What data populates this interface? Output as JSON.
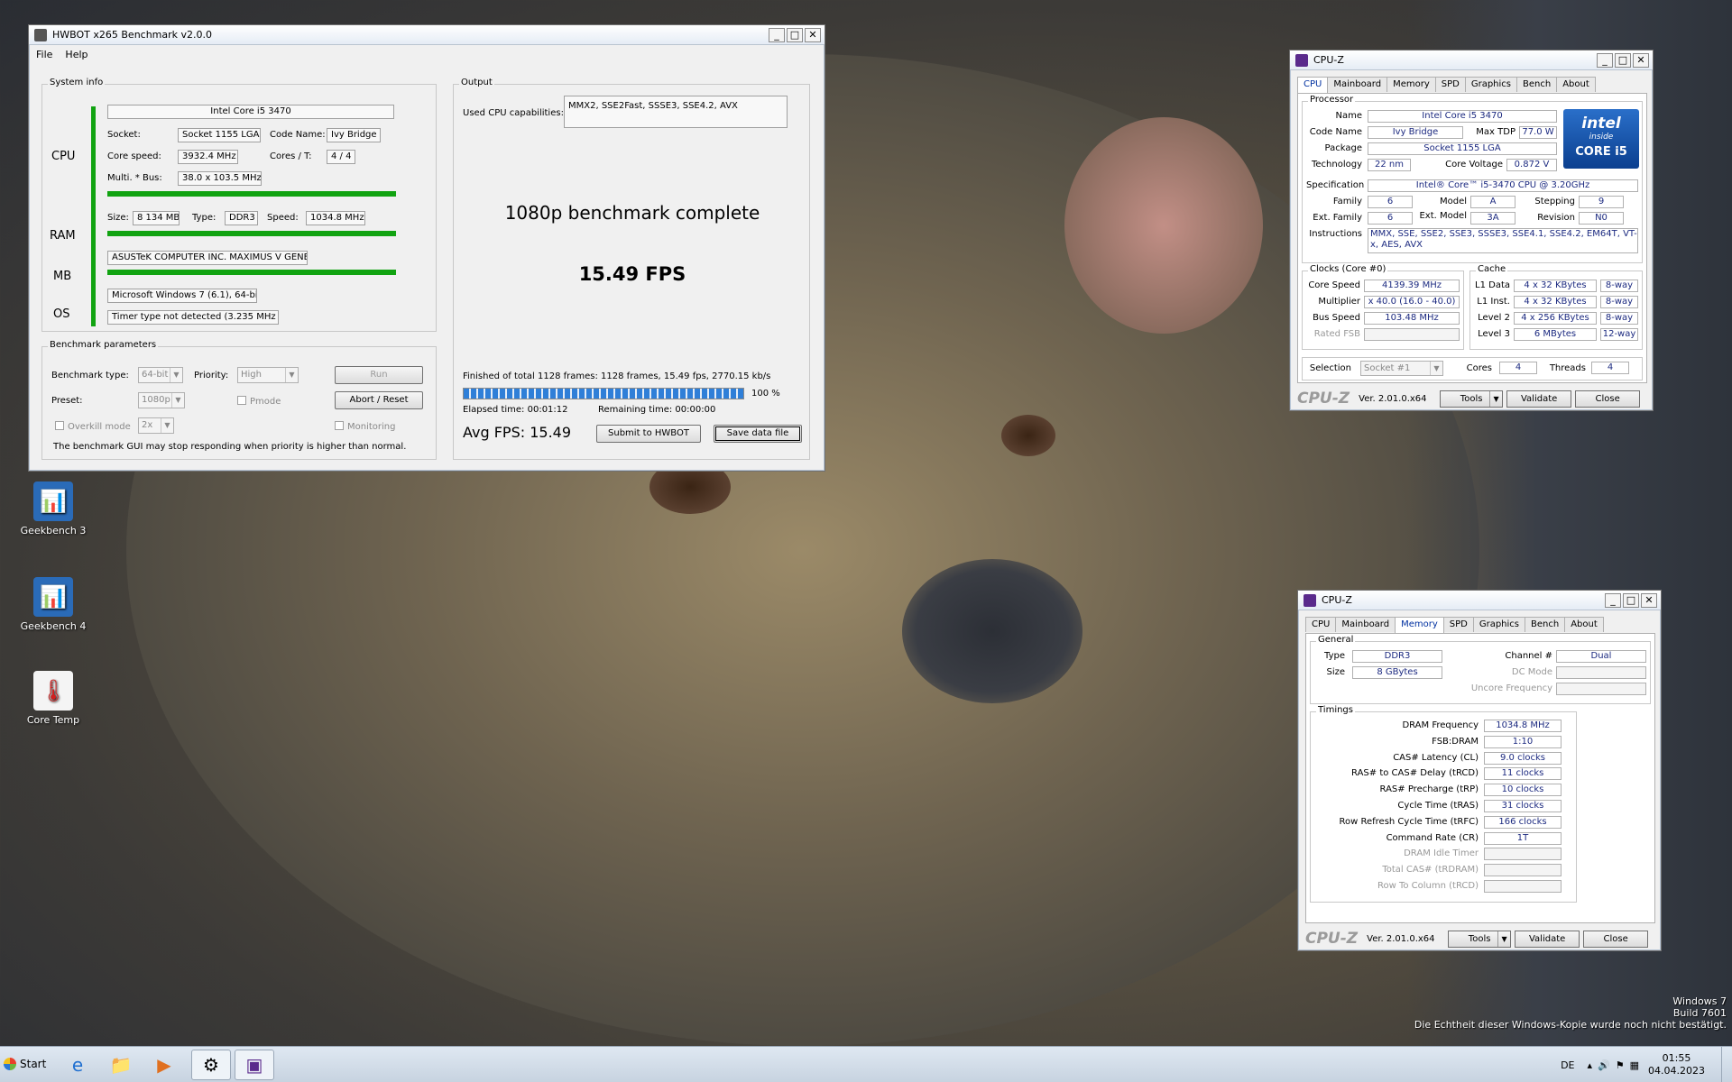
{
  "desktop": {
    "icons": [
      {
        "label": "Geekbench 3"
      },
      {
        "label": "Geekbench 4"
      },
      {
        "label": "Core Temp"
      }
    ],
    "watermark": [
      "Windows 7",
      "Build 7601",
      "Die Echtheit dieser Windows-Kopie wurde noch nicht bestätigt."
    ]
  },
  "hwbot": {
    "title": "HWBOT x265 Benchmark v2.0.0",
    "menu": [
      "File",
      "Help"
    ],
    "system_info": {
      "legend": "System info",
      "cpu_label": "CPU",
      "ram_label": "RAM",
      "mb_label": "MB",
      "os_label": "OS",
      "cpu_name": "Intel Core i5 3470",
      "socket_label": "Socket:",
      "socket": "Socket 1155 LGA",
      "codename_label": "Code Name:",
      "codename": "Ivy Bridge",
      "corespeed_label": "Core speed:",
      "corespeed": "3932.4 MHz",
      "cores_label": "Cores / T:",
      "cores": "4 / 4",
      "multi_label": "Multi. * Bus:",
      "multi": "38.0 x 103.5 MHz",
      "size_label": "Size:",
      "size": "8 134 MB",
      "type_label": "Type:",
      "type": "DDR3",
      "speed_label": "Speed:",
      "speed": "1034.8 MHz",
      "mb": "ASUSTeK COMPUTER INC. MAXIMUS V GENE",
      "os": "Microsoft Windows 7 (6.1), 64-bit",
      "timer": "Timer type not detected (3.235 MHz )"
    },
    "output": {
      "legend": "Output",
      "caps_label": "Used CPU capabilities:",
      "caps": "MMX2, SSE2Fast, SSSE3, SSE4.2, AVX",
      "status": "1080p benchmark complete",
      "fps": "15.49 FPS",
      "finished": "Finished of total 1128 frames: 1128 frames, 15.49 fps,  2770.15 kb/s",
      "progress": 100,
      "progress_text": "100 %",
      "elapsed": "Elapsed time: 00:01:12",
      "remaining": "Remaining time: 00:00:00",
      "avg": "Avg FPS: 15.49",
      "submit": "Submit to HWBOT",
      "save": "Save data file"
    },
    "params": {
      "legend": "Benchmark parameters",
      "type_label": "Benchmark type:",
      "type": "64-bit",
      "priority_label": "Priority:",
      "priority": "High",
      "run": "Run",
      "preset_label": "Preset:",
      "preset": "1080p",
      "pmode": "Pmode",
      "abort": "Abort / Reset",
      "overkill": "Overkill mode",
      "overkill_val": "2x",
      "monitoring": "Monitoring",
      "note": "The benchmark GUI may stop responding when priority is higher than normal."
    }
  },
  "cpuz1": {
    "title": "CPU-Z",
    "tabs": [
      "CPU",
      "Mainboard",
      "Memory",
      "SPD",
      "Graphics",
      "Bench",
      "About"
    ],
    "processor_legend": "Processor",
    "name_l": "Name",
    "name": "Intel Core i5 3470",
    "code_l": "Code Name",
    "code": "Ivy Bridge",
    "tdp_l": "Max TDP",
    "tdp": "77.0 W",
    "pkg_l": "Package",
    "pkg": "Socket 1155 LGA",
    "tech_l": "Technology",
    "tech": "22 nm",
    "volt_l": "Core Voltage",
    "volt": "0.872 V",
    "spec_l": "Specification",
    "spec": "Intel® Core™ i5-3470 CPU @ 3.20GHz",
    "fam_l": "Family",
    "fam": "6",
    "model_l": "Model",
    "model": "A",
    "step_l": "Stepping",
    "step": "9",
    "efam_l": "Ext. Family",
    "efam": "6",
    "emodel_l": "Ext. Model",
    "emodel": "3A",
    "rev_l": "Revision",
    "rev": "N0",
    "inst_l": "Instructions",
    "inst": "MMX, SSE, SSE2, SSE3, SSSE3, SSE4.1, SSE4.2, EM64T, VT-x, AES, AVX",
    "badge_top": "intel",
    "badge_inside": "inside",
    "badge_bottom": "CORE i5",
    "clocks_legend": "Clocks (Core #0)",
    "cs_l": "Core Speed",
    "cs": "4139.39 MHz",
    "mult_l": "Multiplier",
    "mult": "x 40.0 (16.0 - 40.0)",
    "bus_l": "Bus Speed",
    "bus": "103.48 MHz",
    "fsb_l": "Rated FSB",
    "fsb": "",
    "cache_legend": "Cache",
    "l1d_l": "L1 Data",
    "l1d": "4 x 32 KBytes",
    "l1d_w": "8-way",
    "l1i_l": "L1 Inst.",
    "l1i": "4 x 32 KBytes",
    "l1i_w": "8-way",
    "l2_l": "Level 2",
    "l2": "4 x 256 KBytes",
    "l2_w": "8-way",
    "l3_l": "Level 3",
    "l3": "6 MBytes",
    "l3_w": "12-way",
    "sel_l": "Selection",
    "sel": "Socket #1",
    "cores_l": "Cores",
    "cores": "4",
    "threads_l": "Threads",
    "threads": "4",
    "logo": "CPU-Z",
    "ver": "Ver. 2.01.0.x64",
    "tools": "Tools",
    "validate": "Validate",
    "close": "Close"
  },
  "cpuz2": {
    "title": "CPU-Z",
    "tabs": [
      "CPU",
      "Mainboard",
      "Memory",
      "SPD",
      "Graphics",
      "Bench",
      "About"
    ],
    "general_legend": "General",
    "type_l": "Type",
    "type": "DDR3",
    "chan_l": "Channel #",
    "chan": "Dual",
    "size_l": "Size",
    "size": "8 GBytes",
    "dc_l": "DC Mode",
    "dc": "",
    "unc_l": "Uncore Frequency",
    "unc": "",
    "timings_legend": "Timings",
    "t": [
      {
        "l": "DRAM Frequency",
        "v": "1034.8 MHz"
      },
      {
        "l": "FSB:DRAM",
        "v": "1:10"
      },
      {
        "l": "CAS# Latency (CL)",
        "v": "9.0 clocks"
      },
      {
        "l": "RAS# to CAS# Delay (tRCD)",
        "v": "11 clocks"
      },
      {
        "l": "RAS# Precharge (tRP)",
        "v": "10 clocks"
      },
      {
        "l": "Cycle Time (tRAS)",
        "v": "31 clocks"
      },
      {
        "l": "Row Refresh Cycle Time (tRFC)",
        "v": "166 clocks"
      },
      {
        "l": "Command Rate (CR)",
        "v": "1T"
      },
      {
        "l": "DRAM Idle Timer",
        "v": ""
      },
      {
        "l": "Total CAS# (tRDRAM)",
        "v": ""
      },
      {
        "l": "Row To Column (tRCD)",
        "v": ""
      }
    ],
    "logo": "CPU-Z",
    "ver": "Ver. 2.01.0.x64",
    "tools": "Tools",
    "validate": "Validate",
    "close": "Close"
  },
  "taskbar": {
    "start": "Start",
    "lang": "DE",
    "time": "01:55",
    "date": "04.04.2023"
  },
  "colors": {
    "accent_green": "#11a311",
    "progress_blue": "#2f7fd8",
    "cpuz_value": "#1c2a80"
  }
}
